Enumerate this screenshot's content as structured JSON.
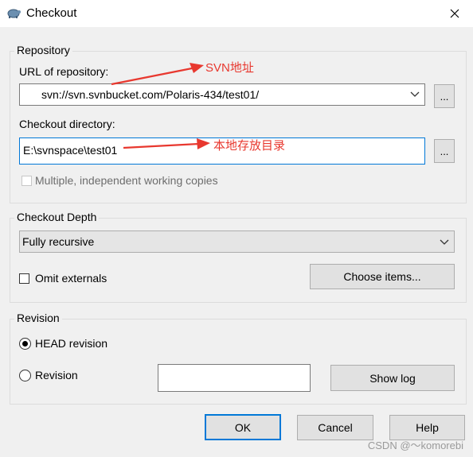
{
  "window": {
    "title": "Checkout"
  },
  "repository": {
    "group_label": "Repository",
    "url_label": "URL of repository:",
    "url_value": "svn://svn.svnbucket.com/Polaris-434/test01/",
    "browse_label": "...",
    "dir_label": "Checkout directory:",
    "dir_value": "E:\\svnspace\\test01",
    "multiple_label": "Multiple, independent working copies"
  },
  "depth": {
    "group_label": "Checkout Depth",
    "selected": "Fully recursive",
    "omit_externals_label": "Omit externals",
    "choose_items_label": "Choose items..."
  },
  "revision": {
    "group_label": "Revision",
    "head_label": "HEAD revision",
    "revision_label": "Revision",
    "revision_value": "",
    "show_log_label": "Show log"
  },
  "buttons": {
    "ok": "OK",
    "cancel": "Cancel",
    "help": "Help"
  },
  "annotations": {
    "svn_address": "SVN地址",
    "local_dir": "本地存放目录",
    "color": "#e8382f"
  },
  "watermark": "CSDN @～komorebi",
  "colors": {
    "focus": "#0078d7",
    "button_face": "#e1e1e1",
    "background": "#f0f0f0"
  }
}
